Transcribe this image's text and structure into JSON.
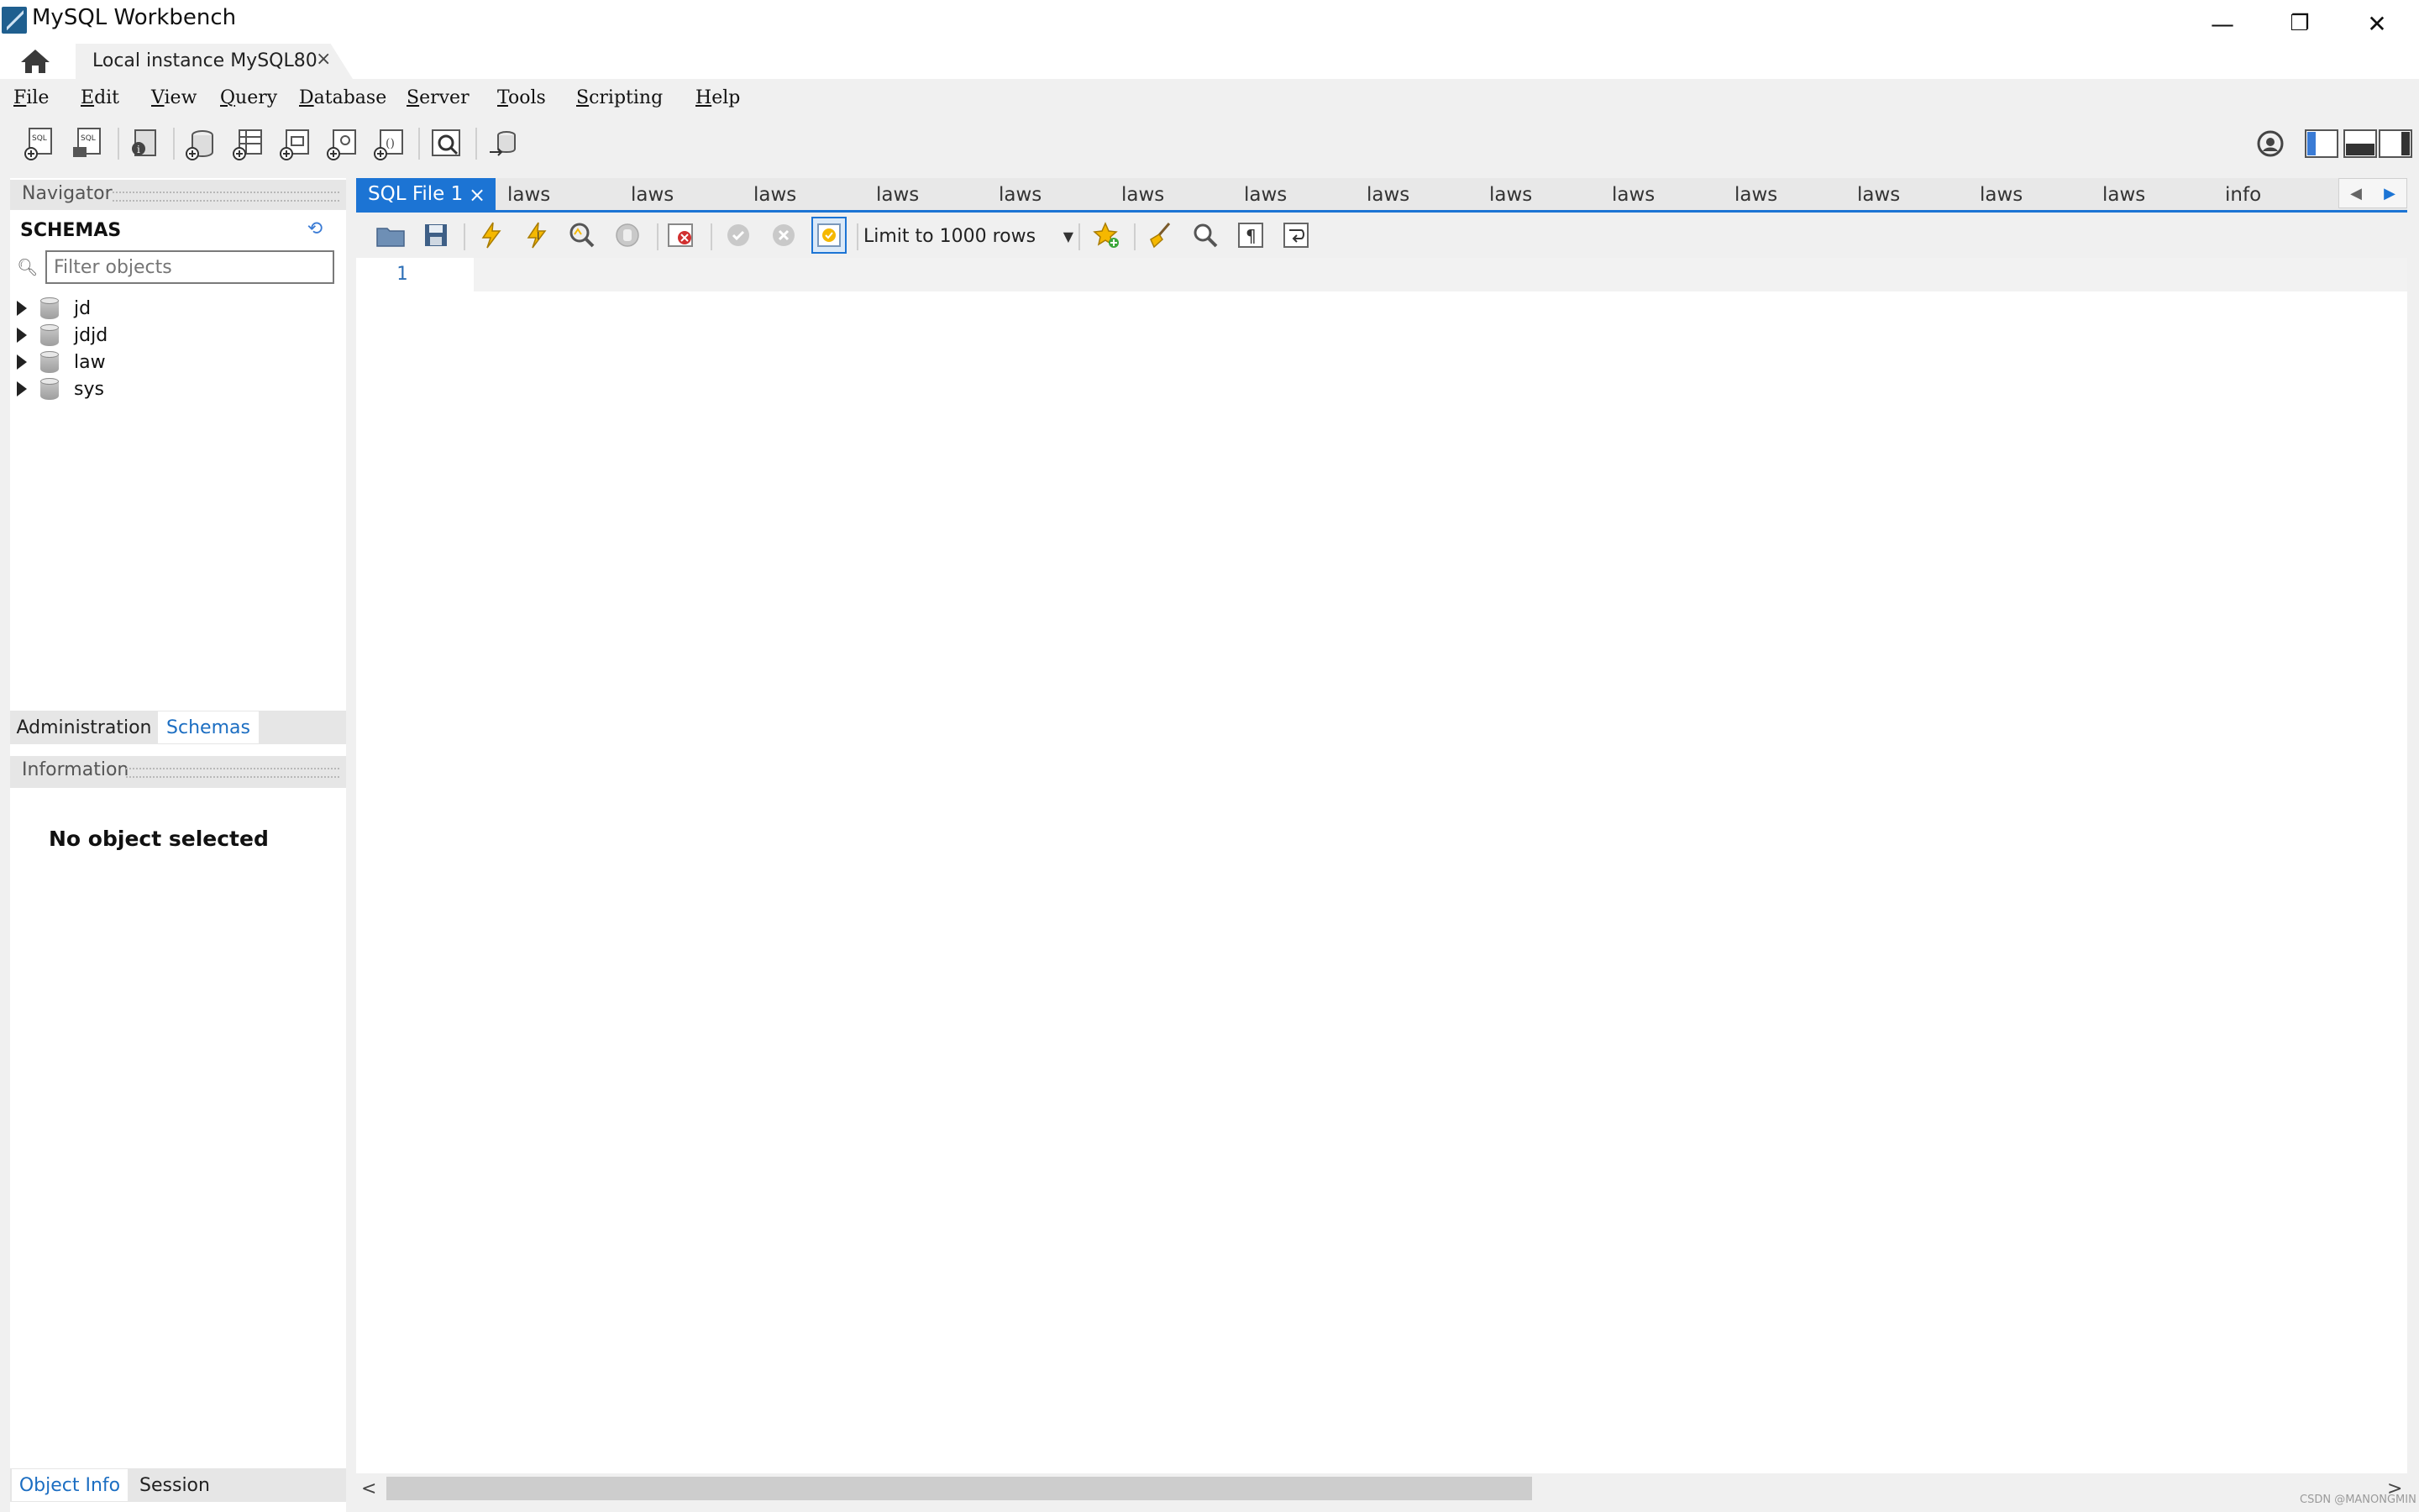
{
  "window": {
    "title": "MySQL Workbench",
    "minimize": "—",
    "restore": "❐",
    "close": "✕"
  },
  "instance_tab": {
    "label": "Local instance MySQL80",
    "close": "×"
  },
  "menu": [
    {
      "key": "F",
      "rest": "ile"
    },
    {
      "key": "E",
      "rest": "dit"
    },
    {
      "key": "V",
      "rest": "iew"
    },
    {
      "key": "Q",
      "rest": "uery"
    },
    {
      "key": "D",
      "rest": "atabase"
    },
    {
      "key": "S",
      "rest": "erver"
    },
    {
      "key": "T",
      "rest": "ools"
    },
    {
      "key": "S",
      "rest": "cripting"
    },
    {
      "key": "H",
      "rest": "elp"
    }
  ],
  "navigator": {
    "header": "Navigator",
    "schemas_title": "SCHEMAS",
    "filter_placeholder": "Filter objects",
    "schemas": [
      "jd",
      "jdjd",
      "law",
      "sys"
    ],
    "tabs": [
      "Administration",
      "Schemas"
    ],
    "active_tab": "Schemas"
  },
  "information": {
    "header": "Information",
    "message": "No object selected",
    "tabs": [
      "Object Info",
      "Session"
    ],
    "active_tab": "Object Info"
  },
  "editor_tabs": {
    "active": "SQL File 1",
    "active_close": "×",
    "others": [
      "laws",
      "laws",
      "laws",
      "laws",
      "laws",
      "laws",
      "laws",
      "laws",
      "laws",
      "laws",
      "laws",
      "laws",
      "laws",
      "laws",
      "info"
    ]
  },
  "editor_toolbar": {
    "limit": "Limit to 1000 rows"
  },
  "editor": {
    "line_number": "1"
  },
  "watermark": "CSDN @MANONGMIN",
  "colors": {
    "accent": "#1c74d4",
    "panel_bg": "#f0f0f0"
  }
}
